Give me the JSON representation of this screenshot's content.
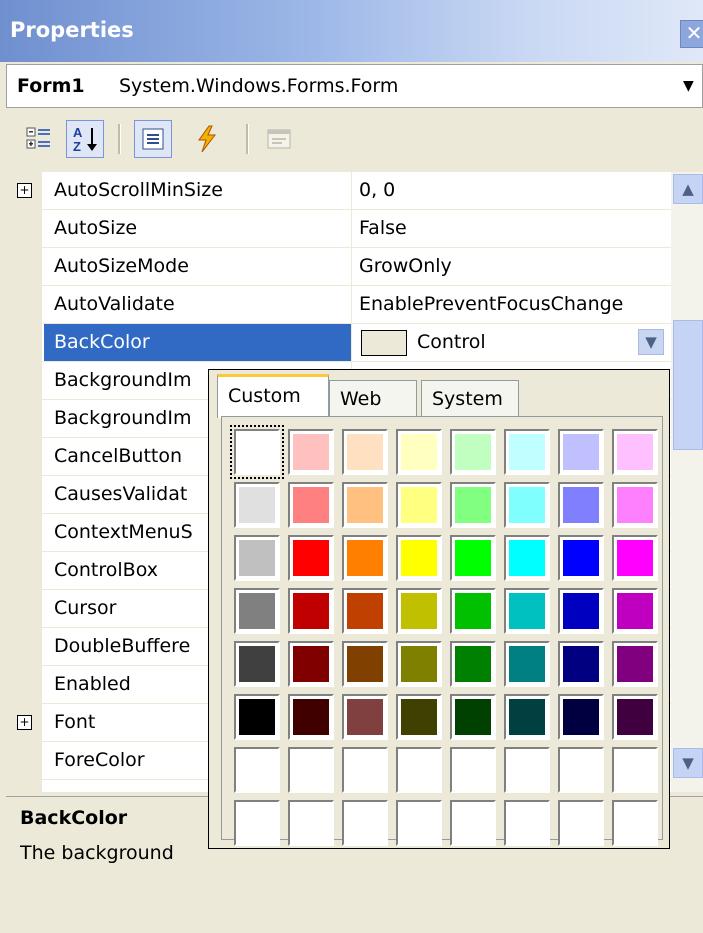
{
  "window": {
    "title": "Properties",
    "close_glyph": "✕"
  },
  "object_selector": {
    "name": "Form1",
    "type": "System.Windows.Forms.Form",
    "arrow": "▼"
  },
  "toolbar": {
    "icons": [
      "categorized-icon",
      "alphabetical-icon",
      "properties-icon",
      "events-icon",
      "property-pages-icon"
    ]
  },
  "properties": [
    {
      "name": "AutoScrollMinSize",
      "value": "0, 0",
      "expandable": true
    },
    {
      "name": "AutoSize",
      "value": "False"
    },
    {
      "name": "AutoSizeMode",
      "value": "GrowOnly"
    },
    {
      "name": "AutoValidate",
      "value": "EnablePreventFocusChange"
    },
    {
      "name": "BackColor",
      "value": "Control",
      "selected": true
    },
    {
      "name": "BackgroundIm",
      "value": ""
    },
    {
      "name": "BackgroundIm",
      "value": ""
    },
    {
      "name": "CancelButton",
      "value": ""
    },
    {
      "name": "CausesValidat",
      "value": ""
    },
    {
      "name": "ContextMenuS",
      "value": ""
    },
    {
      "name": "ControlBox",
      "value": ""
    },
    {
      "name": "Cursor",
      "value": ""
    },
    {
      "name": "DoubleBuffere",
      "value": ""
    },
    {
      "name": "Enabled",
      "value": ""
    },
    {
      "name": "Font",
      "value": "",
      "expandable": true
    },
    {
      "name": "ForeColor",
      "value": ""
    }
  ],
  "scrollbar": {
    "up_glyph": "▲",
    "down_glyph": "▼",
    "dropdown_glyph": "▼"
  },
  "description": {
    "title": "BackColor",
    "text": "The background"
  },
  "color_picker": {
    "tabs": [
      "Custom",
      "Web",
      "System"
    ],
    "active_tab": "Custom",
    "colors": [
      [
        "#ffffff",
        "#ffc0c0",
        "#ffe0c0",
        "#ffffc0",
        "#c0ffc0",
        "#c0ffff",
        "#c0c0ff",
        "#ffc0ff"
      ],
      [
        "#e0e0e0",
        "#ff8080",
        "#ffc080",
        "#ffff80",
        "#80ff80",
        "#80ffff",
        "#8080ff",
        "#ff80ff"
      ],
      [
        "#c0c0c0",
        "#ff0000",
        "#ff8000",
        "#ffff00",
        "#00ff00",
        "#00ffff",
        "#0000ff",
        "#ff00ff"
      ],
      [
        "#808080",
        "#c00000",
        "#c04000",
        "#c0c000",
        "#00c000",
        "#00c0c0",
        "#0000c0",
        "#c000c0"
      ],
      [
        "#404040",
        "#800000",
        "#804000",
        "#808000",
        "#008000",
        "#008080",
        "#000080",
        "#800080"
      ],
      [
        "#000000",
        "#400000",
        "#804040",
        "#404000",
        "#004000",
        "#004040",
        "#000040",
        "#400040"
      ],
      [
        "#ffffff",
        "#ffffff",
        "#ffffff",
        "#ffffff",
        "#ffffff",
        "#ffffff",
        "#ffffff",
        "#ffffff"
      ],
      [
        "#ffffff",
        "#ffffff",
        "#ffffff",
        "#ffffff",
        "#ffffff",
        "#ffffff",
        "#ffffff",
        "#ffffff"
      ]
    ],
    "selected_color": "#ffffff"
  }
}
